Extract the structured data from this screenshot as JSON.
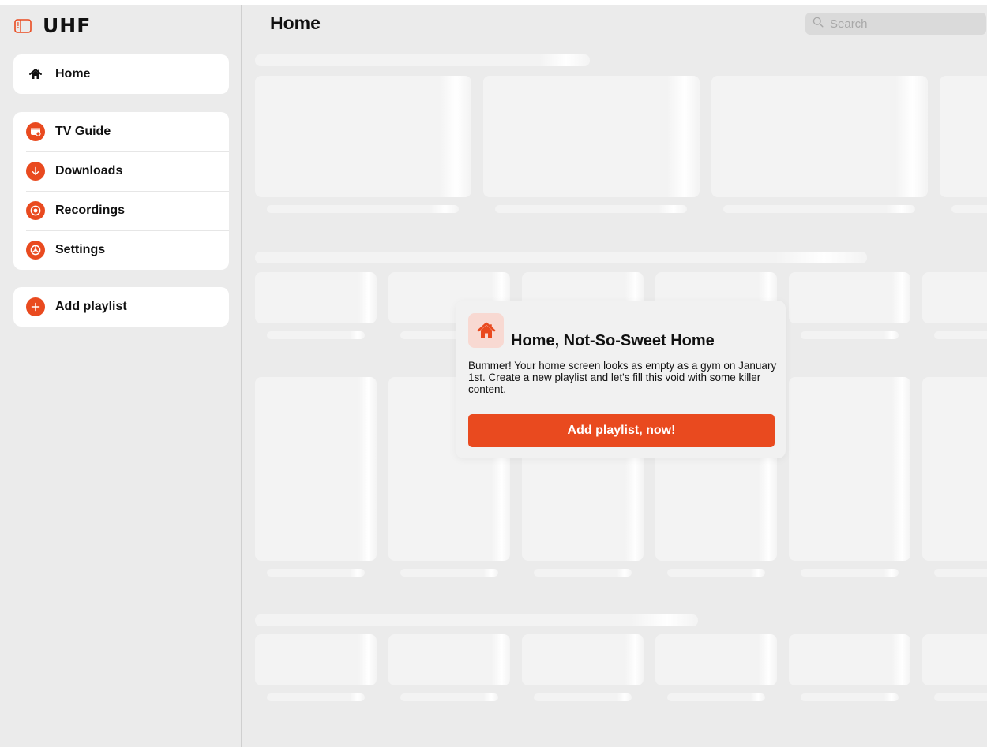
{
  "app": {
    "name": "UHF"
  },
  "sidebar": {
    "home": {
      "label": "Home",
      "icon": "house-icon"
    },
    "nav_items": [
      {
        "label": "TV Guide",
        "icon": "tv-guide-icon"
      },
      {
        "label": "Downloads",
        "icon": "download-icon"
      },
      {
        "label": "Recordings",
        "icon": "record-icon"
      },
      {
        "label": "Settings",
        "icon": "settings-icon"
      }
    ],
    "add_playlist": {
      "label": "Add playlist",
      "icon": "plus-icon"
    }
  },
  "header": {
    "title": "Home",
    "search": {
      "placeholder": "Search",
      "value": ""
    }
  },
  "empty_state": {
    "icon": "house-icon",
    "title": "Home, Not-So-Sweet Home",
    "message": "Bummer! Your home screen looks as empty as a gym on January 1st. Create a new playlist and let's fill this void with some killer content.",
    "button_label": "Add playlist, now!"
  },
  "colors": {
    "accent": "#e94a1f",
    "accent_tint": "#f8d9d2",
    "background": "#ebebeb",
    "surface": "#ffffff",
    "skeleton": "#f3f3f3"
  }
}
